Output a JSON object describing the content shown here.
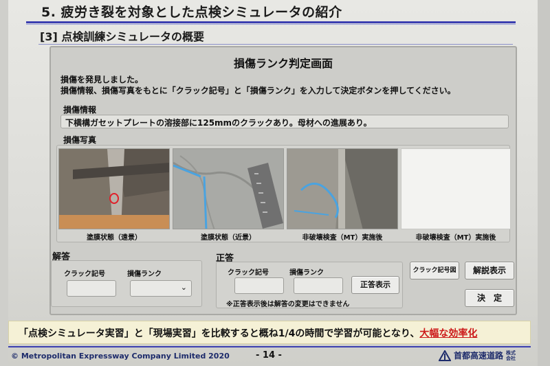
{
  "slide": {
    "title": "5. 疲労き裂を対象とした点検シミュレータの紹介",
    "section": "[3]  点検訓練シミュレータの概要"
  },
  "simulator": {
    "screen_title": "損傷ランク判定画面",
    "intro_line1": "損傷を発見しました。",
    "intro_line2": "損傷情報、損傷写真をもとに「クラック記号」と「損傷ランク」を入力して決定ボタンを押してください。",
    "damage_info_label": "損傷情報",
    "damage_info_text": "下横構ガセットプレートの溶接部に125mmのクラックあり。母材への進展あり。",
    "photo_label": "損傷写真",
    "photos": [
      {
        "caption": "塗膜状態（遠景）"
      },
      {
        "caption": "塗膜状態（近景）"
      },
      {
        "caption": "非破壊検査（MT）実施後"
      },
      {
        "caption": "非破壊検査（MT）実施後"
      }
    ],
    "answer": {
      "label": "解答",
      "crack_label": "クラック記号",
      "rank_label": "損傷ランク",
      "crack_value": "",
      "rank_value": ""
    },
    "correct": {
      "label": "正答",
      "crack_label": "クラック記号",
      "rank_label": "損傷ランク",
      "show_button": "正答表示",
      "note": "※正答表示後は解答の変更はできません"
    },
    "buttons": {
      "crack_diagram": "クラック記号図",
      "explanation": "解説表示",
      "decide": "決　定"
    }
  },
  "summary": {
    "text_prefix": "「点検シミュレータ実習」と「現場実習」を比較すると概ね1/4の時間で学習が可能となり、",
    "highlight": "大幅な効率化"
  },
  "footer": {
    "copyright": "©  Metropolitan Expressway Company Limited  2020",
    "page": "- 14 -",
    "company": "首都高速道路",
    "company_suffix": "株式\n会社"
  },
  "colors": {
    "rule": "#3b3fb0",
    "highlight": "#cc1a1a",
    "mt_blue": "#4aa3e0"
  }
}
